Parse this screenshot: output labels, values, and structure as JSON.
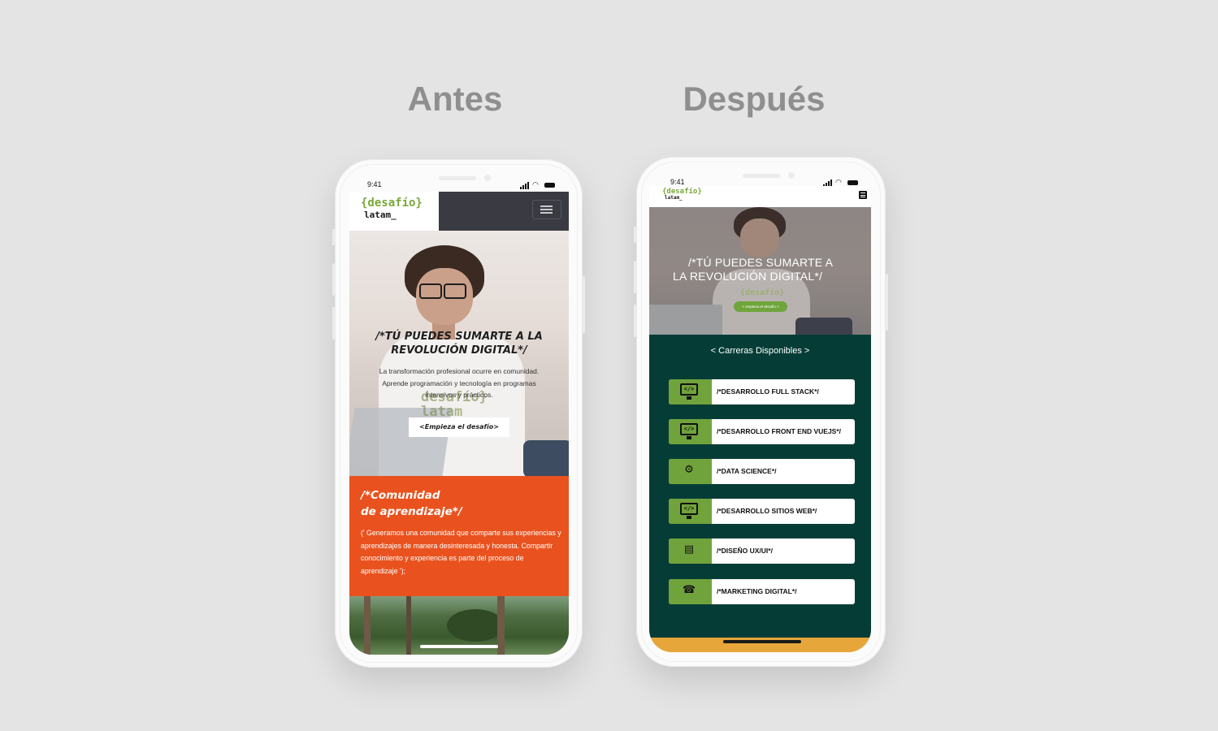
{
  "labels": {
    "before": "Antes",
    "after": "Después"
  },
  "antes": {
    "status_time": "9:41",
    "logo": {
      "top": "{desafío}",
      "bottom": "latam_"
    },
    "hero": {
      "watermark_top": "desafío}",
      "watermark_bottom": "latam_",
      "title": "/*TÚ PUEDES SUMARTE A LA REVOLUCIÓN DIGITAL*/",
      "text": "La transformación profesional ocurre en comunidad. Aprende programación y tecnología en programas intensivos y prácticos.",
      "cta": "<Empieza el desafío>"
    },
    "community": {
      "title_line1": "/*Comunidad",
      "title_line2": "de aprendizaje*/",
      "text": "(' Generamos una comunidad que comparte sus experiencias y aprendizajes de manera desinteresada y honesta. Compartir conocimiento y experiencia es parte del proceso de aprendizaje ');"
    }
  },
  "despues": {
    "status_time": "9:41",
    "logo": {
      "top": "{desafío}",
      "bottom": "latam_"
    },
    "hero": {
      "title_line1": "/*TÚ PUEDES SUMARTE A",
      "title_line2": "LA REVOLUCIÓN DIGITAL*/",
      "watermark": "{desafío}",
      "cta": "< empieza el desafío >"
    },
    "careers_title": "< Carreras Disponibles >",
    "careers": [
      {
        "label": "/*DESARROLLO FULL STACK*/",
        "icon": "monitor-code-icon"
      },
      {
        "label": "/*DESARROLLO FRONT END VUEJS*/",
        "icon": "monitor-code-icon"
      },
      {
        "label": "/*DATA SCIENCE*/",
        "icon": "data-science-icon"
      },
      {
        "label": "/*DESARROLLO SITIOS WEB*/",
        "icon": "monitor-code-icon"
      },
      {
        "label": "/*DISEÑO UX/UI*/",
        "icon": "ux-design-icon"
      },
      {
        "label": "/*MARKETING DIGITAL*/",
        "icon": "marketing-phone-icon"
      }
    ]
  },
  "colors": {
    "orange": "#e9521e",
    "dark_green": "#053d36",
    "brand_green": "#71a33c",
    "yellow": "#e6a63a",
    "header_dark": "#3a3b42"
  }
}
